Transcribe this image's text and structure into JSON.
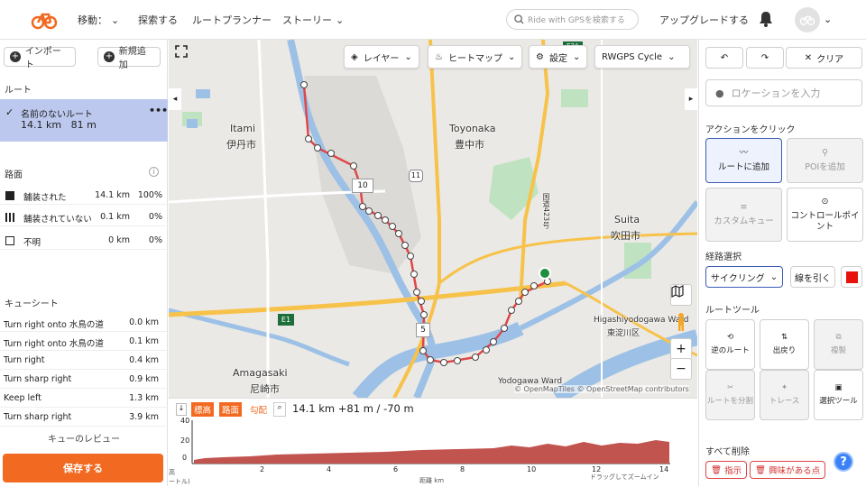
{
  "header": {
    "nav": [
      "移動：",
      "探索する",
      "ルートプランナー",
      "ストーリー"
    ],
    "search_placeholder": "Ride with GPSを検索する",
    "upgrade": "アップグレードする"
  },
  "left": {
    "import_label": "インポート",
    "new_label": "新規追加",
    "routes_title": "ルート",
    "route": {
      "name": "名前のないルート",
      "distance": "14.1 km",
      "elevation": "81 m"
    },
    "surface_title": "路面",
    "surface_rows": [
      {
        "label": "舗装された",
        "km": "14.1 km",
        "pct": "100%"
      },
      {
        "label": "舗装されていない",
        "km": "0.1 km",
        "pct": "0%"
      },
      {
        "label": "不明",
        "km": "0 km",
        "pct": "0%"
      }
    ],
    "cue_title": "キューシート",
    "cues": [
      {
        "text": "Turn right onto 水鳥の道",
        "dist": "0.0 km"
      },
      {
        "text": "Turn right onto 水鳥の道",
        "dist": "0.1 km"
      },
      {
        "text": "Turn right",
        "dist": "0.4 km"
      },
      {
        "text": "Turn sharp right",
        "dist": "0.9 km"
      },
      {
        "text": "Keep left",
        "dist": "1.3 km"
      },
      {
        "text": "Turn sharp right",
        "dist": "3.9 km"
      }
    ],
    "cue_review": "キューのレビュー",
    "save_label": "保存する"
  },
  "map": {
    "layer_label": "レイヤー",
    "heatmap_label": "ヒートマップ",
    "settings_label": "設定",
    "style_label": "RWGPS Cycle",
    "labels": {
      "itami_en": "Itami",
      "itami_ja": "伊丹市",
      "toyonaka_en": "Toyonaka",
      "toyonaka_ja": "豊中市",
      "suita_en": "Suita",
      "suita_ja": "吹田市",
      "amagasaki_en": "Amagasaki",
      "amagasaki_ja": "尼崎市",
      "higashi": "Higashiyodogawa Ward",
      "higashi_ja": "東淀川区",
      "yodogawa": "Yodogawa Ward",
      "road_11": "11",
      "road_e1": "E1",
      "road_e2a": "E2A",
      "route_423": "国道423号"
    },
    "marker_10": "10",
    "marker_5": "5",
    "attribution": "© OpenMapTiles © OpenStreetMap contributors"
  },
  "elevation": {
    "tags": [
      "標高",
      "路面",
      "勾配"
    ],
    "stats": "14.1 km +81 m / -70 m",
    "y_ticks": [
      "40",
      "20",
      "0"
    ],
    "x_ticks": [
      "2",
      "4",
      "6",
      "8",
      "10",
      "12",
      "14"
    ],
    "xlabel": "距離 km",
    "ylabel_frag": "高",
    "ylabel_frag2": "ートル)",
    "hint": "ドラッグしてズームイン"
  },
  "right": {
    "clear_label": "クリア",
    "location_placeholder": "ロケーションを入力",
    "click_action_title": "アクションをクリック",
    "add_to_route": "ルートに追加",
    "add_poi": "POIを追加",
    "custom_cue": "カスタムキュー",
    "control_point": "コントロールポイント",
    "routing_title": "経路選択",
    "routing_mode": "サイクリング",
    "draw_line": "線を引く",
    "route_color": "#e8120c",
    "tools_title": "ルートツール",
    "tools": [
      "逆のルート",
      "出戻り",
      "複製",
      "ルートを分割",
      "トレース",
      "選択ツール"
    ],
    "delete_all_title": "すべて削除",
    "delete_cues": "指示",
    "delete_pois": "興味がある点"
  },
  "colors": {
    "accent": "#f26a21",
    "route": "#e0464a",
    "selected": "#bcc8ee",
    "water": "#9dc1e6",
    "park": "#bfe3c0",
    "highway": "#f7c24a"
  }
}
